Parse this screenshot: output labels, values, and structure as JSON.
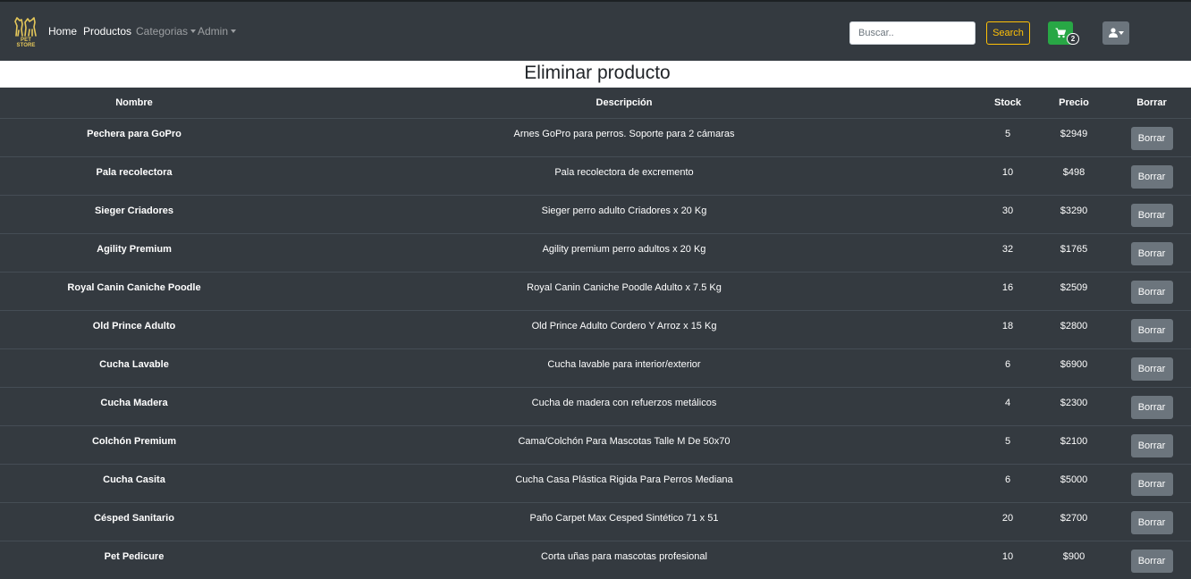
{
  "nav": {
    "logo_text": "PET STORE",
    "links": {
      "home": "Home",
      "productos": "Productos",
      "categorias": "Categorias",
      "admin": "Admin"
    },
    "search_placeholder": "Buscar..",
    "search_label": "Search",
    "cart_count": "2",
    "cart_icon": "shopping-cart-icon",
    "user_icon": "user-icon"
  },
  "page": {
    "title": "Eliminar producto"
  },
  "table": {
    "headers": {
      "nombre": "Nombre",
      "descripcion": "Descripción",
      "stock": "Stock",
      "precio": "Precio",
      "borrar": "Borrar"
    },
    "action_label": "Borrar",
    "rows": [
      {
        "nombre": "Pechera para GoPro",
        "descripcion": "Arnes GoPro para perros. Soporte para 2 cámaras",
        "stock": "5",
        "precio": "$2949"
      },
      {
        "nombre": "Pala recolectora",
        "descripcion": "Pala recolectora de excremento",
        "stock": "10",
        "precio": "$498"
      },
      {
        "nombre": "Sieger Criadores",
        "descripcion": "Sieger perro adulto Criadores x 20 Kg",
        "stock": "30",
        "precio": "$3290"
      },
      {
        "nombre": "Agility Premium",
        "descripcion": "Agility premium perro adultos x 20 Kg",
        "stock": "32",
        "precio": "$1765"
      },
      {
        "nombre": "Royal Canin Caniche Poodle",
        "descripcion": "Royal Canin Caniche Poodle Adulto x 7.5 Kg",
        "stock": "16",
        "precio": "$2509"
      },
      {
        "nombre": "Old Prince Adulto",
        "descripcion": "Old Prince Adulto Cordero Y Arroz x 15 Kg",
        "stock": "18",
        "precio": "$2800"
      },
      {
        "nombre": "Cucha Lavable",
        "descripcion": "Cucha lavable para interior/exterior",
        "stock": "6",
        "precio": "$6900"
      },
      {
        "nombre": "Cucha Madera",
        "descripcion": "Cucha de madera con refuerzos metálicos",
        "stock": "4",
        "precio": "$2300"
      },
      {
        "nombre": "Colchón Premium",
        "descripcion": "Cama/Colchón Para Mascotas Talle M De 50x70",
        "stock": "5",
        "precio": "$2100"
      },
      {
        "nombre": "Cucha Casita",
        "descripcion": "Cucha Casa Plástica Rigida Para Perros Mediana",
        "stock": "6",
        "precio": "$5000"
      },
      {
        "nombre": "Césped Sanitario",
        "descripcion": "Paño Carpet Max Cesped Sintético 71 x 51",
        "stock": "20",
        "precio": "$2700"
      },
      {
        "nombre": "Pet Pedicure",
        "descripcion": "Corta uñas para mascotas profesional",
        "stock": "10",
        "precio": "$900"
      }
    ]
  },
  "colors": {
    "navbar_bg": "#343a40",
    "search_outline": "#ffc107",
    "cart_green": "#28a745",
    "button_gray": "#6c757d",
    "logo_gold": "#e6c85a"
  }
}
